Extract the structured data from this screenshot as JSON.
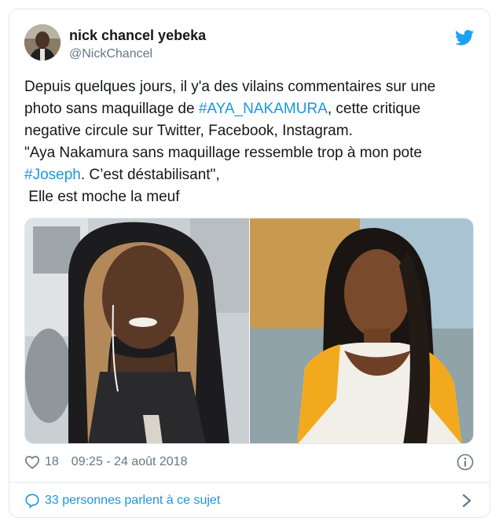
{
  "author": {
    "name": "nick chancel yebeka",
    "handle": "@NickChancel"
  },
  "tweet": {
    "line1": "Depuis quelques jours, il y'a des vilains commentaires sur une",
    "line2_pre": "photo sans maquillage de ",
    "hashtag1": "#AYA_NAKAMURA",
    "line2_post": ", cette critique",
    "line3": "negative circule sur Twitter, Facebook, Instagram.",
    "line4": "\"Aya Nakamura sans maquillage ressemble trop à mon pote",
    "hashtag2": "#Joseph",
    "line5_post": ". C’est déstabilisant\",",
    "line6": " Elle est moche la meuf"
  },
  "meta": {
    "likes": "18",
    "timestamp": "09:25 - 24 août 2018"
  },
  "footer": {
    "conversation": "33 personnes parlent à ce sujet"
  },
  "colors": {
    "link": "#1b95e0",
    "secondary": "#657786",
    "border": "#e1e8ed"
  },
  "icons": [
    "twitter-bird-icon",
    "heart-icon",
    "info-icon",
    "comment-bubble-icon",
    "chevron-right-icon"
  ]
}
